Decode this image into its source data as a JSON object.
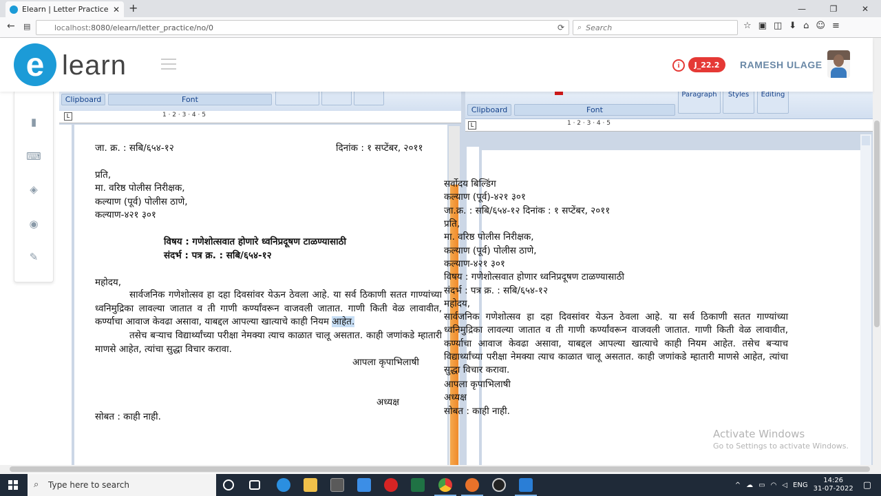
{
  "browser": {
    "tab_title": "Elearn | Letter Practice",
    "tab_close": "✕",
    "new_tab": "+",
    "url_host": "localhost",
    "url_path": ":8080/elearn/letter_practice/no/0",
    "search_placeholder": "Search",
    "back": "←",
    "reload": "⟳",
    "minimize": "—",
    "maximize": "❐",
    "close": "✕"
  },
  "header": {
    "logo_letter": "e",
    "logo_text": "learn",
    "info_glyph": "i",
    "badge": "J_22.2",
    "user_name": "RAMESH ULAGE"
  },
  "left_doc": {
    "ribbon": {
      "clipboard": "Clipboard",
      "font": "Font"
    },
    "ruler_numbers": "1      ·      2      ·      3      ·      4      ·      5",
    "jaak": "जा. क्र. : सबि/६५४-१२",
    "date": "दिनांक : १ सप्टेंबर, २०११",
    "prati": "प्रति,",
    "addr1": "मा. वरिष्ठ पोलीस निरीक्षक,",
    "addr2": "कल्याण (पूर्व) पोलीस ठाणे,",
    "addr3": "कल्याण-४२१ ३०१",
    "subject": "विषय : गणेशोत्सवात होणारे ध्वनिप्रदूषण टाळण्यासाठी",
    "reference": "संदर्भ : पत्र क्र. : सबि/६५४-१२",
    "greeting": "महोदय,",
    "para1_main": "सार्वजनिक गणेशोत्सव हा दहा दिवसांवर येऊन ठेवला आहे. या सर्व ठिकाणी सतत गाण्यांच्या ध्वनिमुद्रिका लावल्या जातात व ती गाणी कर्ण्यांवरून वाजवली जातात. गाणी किती वेळ लावावीत, कर्ण्याचा आवाज केवढा असावा, याबद्दल आपल्या खात्याचे काही नियम",
    "para1_highlight": "आहेत.",
    "para2": "तसेच बऱ्याच विद्यार्थ्यांच्या परीक्षा नेमक्या त्याच काळात चालू असतात. काही जणांकडे म्हातारी माणसे आहेत, त्यांचा सुद्धा विचार करावा.",
    "closing": "आपला कृपाभिलाषी",
    "designation": "अध्यक्ष",
    "enclosure": "सोबत : काही नाही."
  },
  "right_doc": {
    "ribbon": {
      "clipboard": "Clipboard",
      "font": "Font",
      "paragraph": "Paragraph",
      "styles": "Styles",
      "editing": "Editing"
    },
    "ruler_numbers": "1      ·      2      ·      3      ·      4      ·      5",
    "lines": [
      "सर्वोदय बिल्डिंग",
      "कल्याण (पूर्व)-४२१ ३०१",
      "जा.क्र. : सबि/६५४-१२ दिनांक : १ सप्टेंबर, २०११",
      "प्रति,",
      "मा. वरिष्ठ पोलीस निरीक्षक,",
      "कल्याण (पूर्व) पोलीस ठाणे,",
      "कल्याण-४२१ ३०१",
      "विषय : गणेशोत्सवात होणार ध्वनिप्रदूषण टाळण्यासाठी",
      "संदर्भ : पत्र क्र. : सबि/६५४-१२",
      "महोदय,"
    ],
    "para1": "सार्वजनिक गणेशोत्सव हा दहा दिवसांवर येऊन ठेवला आहे. या सर्व ठिकाणी सतत गाण्यांच्या ध्वनिमुद्रिका लावल्या जातात व ती गाणी कर्ण्यांवरून वाजवली जातात. गाणी किती वेळ लावावीत, कर्ण्याचा आवाज केवढा असावा, याबद्दल आपल्या खात्याचे काही नियम आहेत. तसेच बऱ्याच विद्यार्थ्यांच्या परीक्षा नेमक्या त्याच काळात चालू असतात. काही जणांकडे म्हातारी माणसे आहेत, त्यांचा सुद्धा विचार करावा.",
    "closing": "आपला कृपाभिलाषी",
    "designation": "अध्यक्ष",
    "enclosure": "सोबत : काही नाही."
  },
  "watermark": {
    "line1": "Activate Windows",
    "line2": "Go to Settings to activate Windows."
  },
  "taskbar": {
    "search_text": "Type here to search",
    "lang": "ENG",
    "time": "14:26",
    "date": "31-07-2022"
  },
  "colors": {
    "brand": "#1c9bd7",
    "badge": "#e53935",
    "username": "#6a88a6",
    "scroll_thumb": "#f08a2a"
  }
}
